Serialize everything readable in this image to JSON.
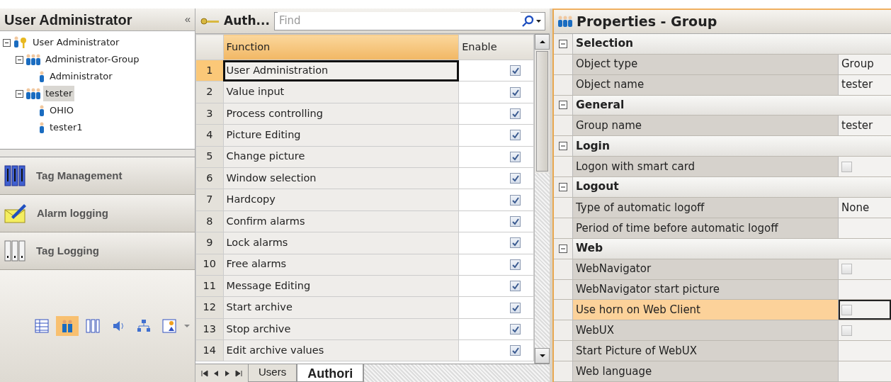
{
  "left_panel": {
    "title": "User Administrator",
    "collapse_glyph": "«",
    "tree": [
      {
        "label": "User Administrator",
        "kind": "admin",
        "expanded": true,
        "selected": false,
        "children": [
          {
            "label": "Administrator-Group",
            "kind": "group",
            "expanded": true,
            "selected": false,
            "children": [
              {
                "label": "Administrator",
                "kind": "user",
                "selected": false
              }
            ]
          },
          {
            "label": "tester",
            "kind": "group",
            "expanded": true,
            "selected": true,
            "children": [
              {
                "label": "OHIO",
                "kind": "user",
                "selected": false
              },
              {
                "label": "tester1",
                "kind": "user",
                "selected": false
              }
            ]
          }
        ]
      }
    ],
    "nav_buttons": [
      {
        "label": "Tag Management",
        "kind": "tags"
      },
      {
        "label": "Alarm logging",
        "kind": "alarm"
      },
      {
        "label": "Tag Logging",
        "kind": "logging"
      }
    ],
    "icon_bar": [
      {
        "kind": "grid",
        "selected": false
      },
      {
        "kind": "users",
        "selected": true
      },
      {
        "kind": "logging",
        "selected": false
      },
      {
        "kind": "speaker",
        "selected": false
      },
      {
        "kind": "network",
        "selected": false
      },
      {
        "kind": "ranking",
        "selected": false
      }
    ]
  },
  "middle_panel": {
    "title": "Auth...",
    "search": {
      "placeholder": "Find"
    },
    "table": {
      "columns": [
        "Function",
        "Enable"
      ],
      "rows": [
        {
          "number": "1",
          "function": "User Administration",
          "enabled": true,
          "selected": true
        },
        {
          "number": "2",
          "function": "Value input",
          "enabled": true,
          "selected": false
        },
        {
          "number": "3",
          "function": "Process controlling",
          "enabled": true,
          "selected": false
        },
        {
          "number": "4",
          "function": "Picture Editing",
          "enabled": true,
          "selected": false
        },
        {
          "number": "5",
          "function": "Change picture",
          "enabled": true,
          "selected": false
        },
        {
          "number": "6",
          "function": "Window selection",
          "enabled": true,
          "selected": false
        },
        {
          "number": "7",
          "function": "Hardcopy",
          "enabled": true,
          "selected": false
        },
        {
          "number": "8",
          "function": "Confirm alarms",
          "enabled": true,
          "selected": false
        },
        {
          "number": "9",
          "function": "Lock alarms",
          "enabled": true,
          "selected": false
        },
        {
          "number": "10",
          "function": "Free alarms",
          "enabled": true,
          "selected": false
        },
        {
          "number": "11",
          "function": "Message Editing",
          "enabled": true,
          "selected": false
        },
        {
          "number": "12",
          "function": "Start archive",
          "enabled": true,
          "selected": false
        },
        {
          "number": "13",
          "function": "Stop archive",
          "enabled": true,
          "selected": false
        },
        {
          "number": "14",
          "function": "Edit archive values",
          "enabled": true,
          "selected": false
        }
      ]
    },
    "sheet_tabs": [
      {
        "label": "Users",
        "selected": false
      },
      {
        "label": "Authori",
        "selected": true
      }
    ]
  },
  "properties": {
    "title": "Properties - Group",
    "rows": [
      {
        "kind": "section",
        "label": "Selection",
        "expanded": true
      },
      {
        "kind": "text",
        "label": "Object type",
        "value": "Group",
        "selected": false
      },
      {
        "kind": "text",
        "label": "Object name",
        "value": "tester",
        "selected": false
      },
      {
        "kind": "section",
        "label": "General",
        "expanded": true
      },
      {
        "kind": "text",
        "label": "Group name",
        "value": "tester",
        "selected": false
      },
      {
        "kind": "section",
        "label": "Login",
        "expanded": true
      },
      {
        "kind": "checkbox",
        "label": "Logon with smart card",
        "checked": false,
        "selected": false
      },
      {
        "kind": "section",
        "label": "Logout",
        "expanded": true
      },
      {
        "kind": "text",
        "label": "Type of automatic logoff",
        "value": "None",
        "selected": false
      },
      {
        "kind": "text",
        "label": "Period of time before automatic logoff",
        "selected": false
      },
      {
        "kind": "section",
        "label": "Web",
        "expanded": true
      },
      {
        "kind": "checkbox",
        "label": "WebNavigator",
        "checked": false,
        "selected": false
      },
      {
        "kind": "text",
        "label": "WebNavigator start picture",
        "selected": false
      },
      {
        "kind": "checkbox",
        "label": "Use horn on Web Client",
        "checked": false,
        "selected": true
      },
      {
        "kind": "checkbox",
        "label": "WebUX",
        "checked": false,
        "selected": false
      },
      {
        "kind": "text",
        "label": "Start Picture of WebUX",
        "selected": false
      },
      {
        "kind": "text",
        "label": "Web language",
        "selected": false
      }
    ]
  }
}
